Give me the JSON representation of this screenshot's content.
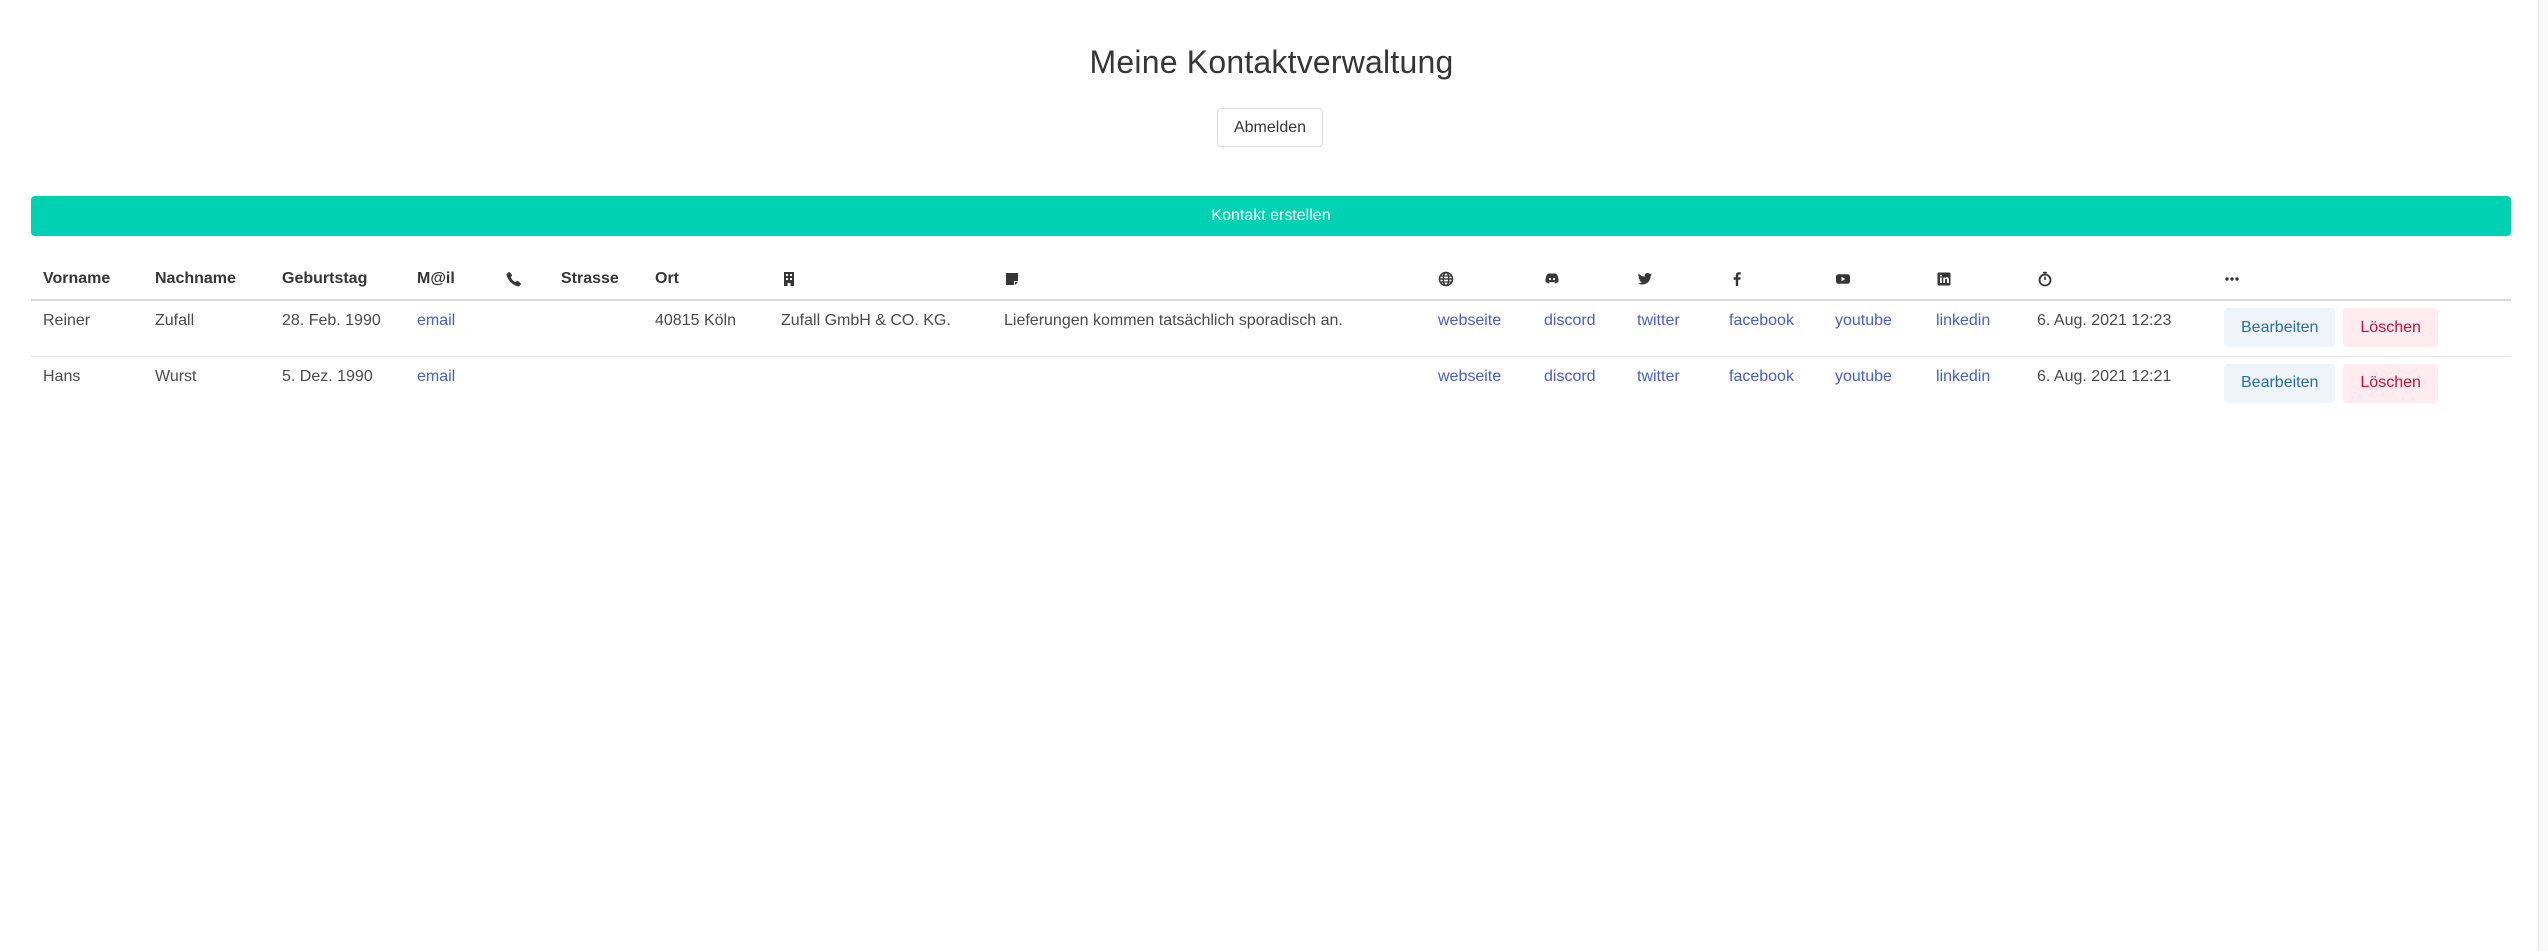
{
  "header": {
    "title": "Meine Kontaktverwaltung",
    "logout_label": "Abmelden"
  },
  "create_button": {
    "label": "Kontakt erstellen"
  },
  "table": {
    "columns": [
      {
        "key": "vorname",
        "label": "Vorname"
      },
      {
        "key": "nachname",
        "label": "Nachname"
      },
      {
        "key": "geburtstag",
        "label": "Geburtstag"
      },
      {
        "key": "mail",
        "label": "M@il"
      },
      {
        "key": "phone",
        "icon": "phone-icon"
      },
      {
        "key": "strasse",
        "label": "Strasse"
      },
      {
        "key": "ort",
        "label": "Ort"
      },
      {
        "key": "firma",
        "icon": "building-icon"
      },
      {
        "key": "notiz",
        "icon": "sticky-note-icon"
      },
      {
        "key": "webseite",
        "icon": "globe-icon"
      },
      {
        "key": "discord",
        "icon": "discord-icon"
      },
      {
        "key": "twitter",
        "icon": "twitter-icon"
      },
      {
        "key": "facebook",
        "icon": "facebook-icon"
      },
      {
        "key": "youtube",
        "icon": "youtube-icon"
      },
      {
        "key": "linkedin",
        "icon": "linkedin-icon"
      },
      {
        "key": "zeit",
        "icon": "stopwatch-icon"
      },
      {
        "key": "aktionen",
        "icon": "ellipsis-icon"
      }
    ],
    "rows": [
      {
        "vorname": "Reiner",
        "nachname": "Zufall",
        "geburtstag": "28. Feb. 1990",
        "mail": "email",
        "phone": "",
        "strasse": "",
        "ort": "40815 Köln",
        "firma": "Zufall GmbH & CO. KG.",
        "notiz": "Lieferungen kommen tatsächlich sporadisch an.",
        "webseite": "webseite",
        "discord": "discord",
        "twitter": "twitter",
        "facebook": "facebook",
        "youtube": "youtube",
        "linkedin": "linkedin",
        "zeit": "6. Aug. 2021 12:23",
        "edit_label": "Bearbeiten",
        "delete_label": "Löschen"
      },
      {
        "vorname": "Hans",
        "nachname": "Wurst",
        "geburtstag": "5. Dez. 1990",
        "mail": "email",
        "phone": "",
        "strasse": "",
        "ort": "",
        "firma": "",
        "notiz": "",
        "webseite": "webseite",
        "discord": "discord",
        "twitter": "twitter",
        "facebook": "facebook",
        "youtube": "youtube",
        "linkedin": "linkedin",
        "zeit": "6. Aug. 2021 12:21",
        "edit_label": "Bearbeiten",
        "delete_label": "Löschen"
      }
    ]
  },
  "colors": {
    "primary": "#00d1b2",
    "link": "#485fc7",
    "info_light": "#eff5fb",
    "info_text": "#296fa8",
    "danger_light": "#feecf0",
    "danger_text": "#cc0f35"
  }
}
